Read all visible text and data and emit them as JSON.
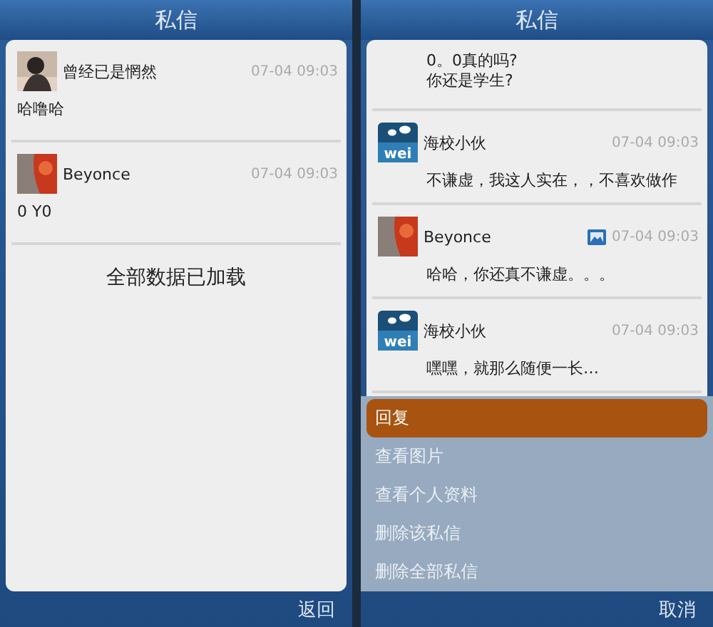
{
  "screens": [
    {
      "title": "私信",
      "messages": [
        {
          "name": "曾经已是惘然",
          "time": "07-04 09:03",
          "lines": [
            "哈噜哈"
          ],
          "avatar": {
            "kind": "person"
          },
          "has_image": false
        },
        {
          "name": "Beyonce",
          "time": "07-04 09:03",
          "lines": [
            "0 Y0"
          ],
          "avatar": {
            "kind": "red"
          },
          "has_image": false
        }
      ],
      "status": "全部数据已加载",
      "footer_button": "返回"
    },
    {
      "title": "私信",
      "messages": [
        {
          "lines": [
            "0。0真的吗?",
            "你还是学生?"
          ]
        },
        {
          "name": "海校小伙",
          "time": "07-04 09:03",
          "lines": [
            "不谦虚，我这人实在，，不喜欢做作"
          ],
          "avatar": {
            "kind": "logo",
            "text": "wei"
          },
          "has_image": false
        },
        {
          "name": "Beyonce",
          "time": "07-04 09:03",
          "lines": [
            "哈哈，你还真不谦虚。。。"
          ],
          "avatar": {
            "kind": "red"
          },
          "has_image": true
        },
        {
          "name": "海校小伙",
          "time": "07-04 09:03",
          "lines": [
            "嘿嘿，就那么随便一长…"
          ],
          "avatar": {
            "kind": "logo",
            "text": "wei"
          },
          "has_image": false
        }
      ],
      "menu": [
        {
          "label": "回复",
          "selected": true
        },
        {
          "label": "查看图片",
          "selected": false
        },
        {
          "label": "查看个人资料",
          "selected": false
        },
        {
          "label": "删除该私信",
          "selected": false
        },
        {
          "label": "删除全部私信",
          "selected": false
        }
      ],
      "footer_button": "取消"
    }
  ]
}
